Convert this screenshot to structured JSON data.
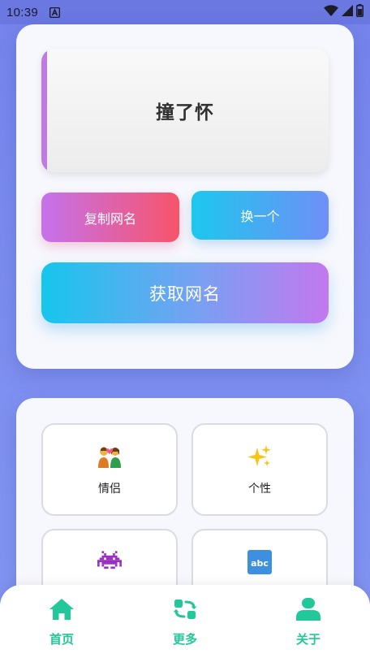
{
  "status_bar": {
    "time": "10:39"
  },
  "generator": {
    "current_name": "撞了怀",
    "copy_label": "复制网名",
    "swap_label": "换一个",
    "get_label": "获取网名"
  },
  "categories": [
    {
      "label": "情侣",
      "icon": "couple-icon"
    },
    {
      "label": "个性",
      "icon": "sparkles-icon"
    },
    {
      "label": "",
      "icon": "space-invader-icon"
    },
    {
      "label": "",
      "icon": "abc-icon"
    }
  ],
  "tabbar": {
    "items": [
      {
        "label": "首页",
        "icon": "home-icon"
      },
      {
        "label": "更多",
        "icon": "refresh-icon"
      },
      {
        "label": "关于",
        "icon": "user-icon"
      }
    ]
  },
  "colors": {
    "accent": "#22c79a",
    "background": "#7583ec",
    "card": "#f7f8fd",
    "name_bar": "#c07ae6"
  }
}
